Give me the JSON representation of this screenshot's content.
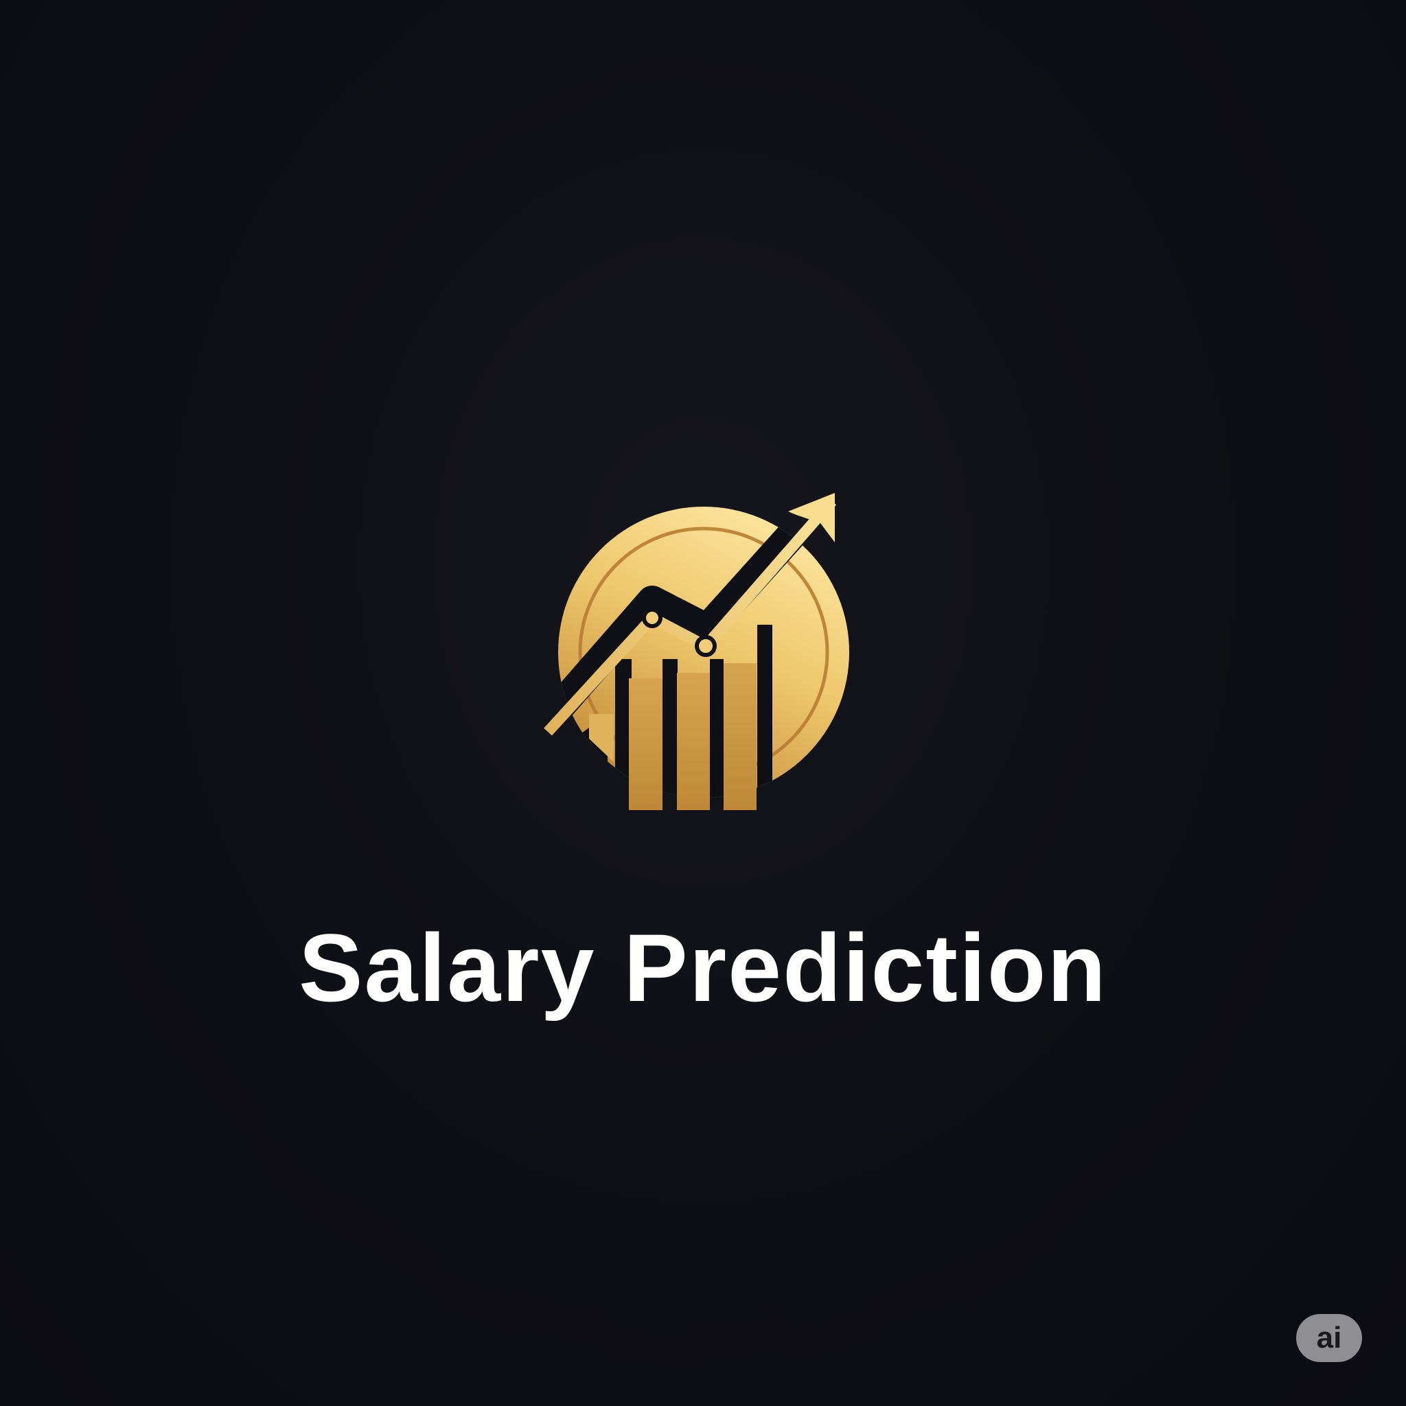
{
  "title": "Salary Prediction",
  "badge": {
    "label": "ai"
  },
  "logo": {
    "icon": "gold-coin-growth-chart-icon",
    "colors": {
      "gold_light": "#f8de8f",
      "gold_mid": "#e6bb5e",
      "gold_dark": "#b88434",
      "background": "#0f1015",
      "title": "#ffffff",
      "badge_bg": "#8f8f93"
    }
  }
}
